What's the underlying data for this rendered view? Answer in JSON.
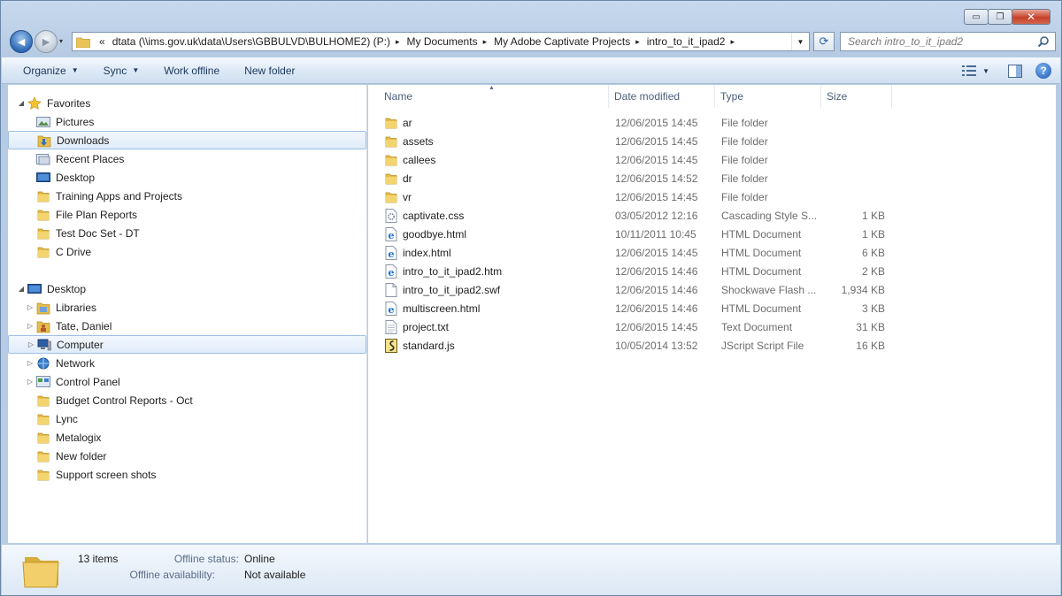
{
  "window": {
    "caption_buttons": {
      "minimize": "▭",
      "maximize": "❐",
      "close": "✕"
    }
  },
  "nav": {
    "back_glyph": "◄",
    "forward_glyph": "►",
    "history_glyph": "▾",
    "address_overflow": "«",
    "breadcrumbs": [
      "dtata (\\\\ims.gov.uk\\data\\Users\\GBBULVD\\BULHOME2) (P:)",
      "My Documents",
      "My Adobe Captivate Projects",
      "intro_to_it_ipad2"
    ],
    "crumb_separator": "▸",
    "address_dropdown_glyph": "▼",
    "refresh_glyph": "⟳",
    "search_placeholder": "Search intro_to_it_ipad2"
  },
  "toolbar": {
    "organize": "Organize",
    "sync": "Sync",
    "work_offline": "Work offline",
    "new_folder": "New folder",
    "dropdown_glyph": "▼",
    "help_glyph": "?"
  },
  "navpane": {
    "expander_open": "◢",
    "expander_closed": "▷",
    "favorites_label": "Favorites",
    "favorites": [
      {
        "label": "Pictures",
        "icon": "pictures-icon"
      },
      {
        "label": "Downloads",
        "icon": "downloads-icon",
        "selected": true
      },
      {
        "label": "Recent Places",
        "icon": "recent-places-icon"
      },
      {
        "label": "Desktop",
        "icon": "desktop-icon"
      },
      {
        "label": "Training Apps and Projects",
        "icon": "folder-icon"
      },
      {
        "label": "File Plan Reports",
        "icon": "folder-icon"
      },
      {
        "label": "Test Doc Set - DT",
        "icon": "folder-icon"
      },
      {
        "label": "C Drive",
        "icon": "folder-icon"
      }
    ],
    "desktop_label": "Desktop",
    "desktop_children": [
      {
        "label": "Libraries",
        "icon": "libraries-icon",
        "expandable": true
      },
      {
        "label": "Tate, Daniel",
        "icon": "user-folder-icon",
        "expandable": true
      },
      {
        "label": "Computer",
        "icon": "computer-icon",
        "expandable": true,
        "selected": true
      },
      {
        "label": "Network",
        "icon": "network-icon",
        "expandable": true
      },
      {
        "label": "Control Panel",
        "icon": "control-panel-icon",
        "expandable": true
      },
      {
        "label": "Budget Control Reports - Oct",
        "icon": "folder-icon"
      },
      {
        "label": "Lync",
        "icon": "folder-icon"
      },
      {
        "label": "Metalogix",
        "icon": "folder-icon"
      },
      {
        "label": "New folder",
        "icon": "folder-icon"
      },
      {
        "label": "Support screen shots",
        "icon": "folder-icon"
      }
    ]
  },
  "filelist": {
    "columns": {
      "name": "Name",
      "date": "Date modified",
      "type": "Type",
      "size": "Size"
    },
    "sort_glyph": "▲",
    "rows": [
      {
        "name": "ar",
        "date": "12/06/2015 14:45",
        "type": "File folder",
        "size": "",
        "icon": "folder-icon"
      },
      {
        "name": "assets",
        "date": "12/06/2015 14:45",
        "type": "File folder",
        "size": "",
        "icon": "folder-icon"
      },
      {
        "name": "callees",
        "date": "12/06/2015 14:45",
        "type": "File folder",
        "size": "",
        "icon": "folder-icon"
      },
      {
        "name": "dr",
        "date": "12/06/2015 14:52",
        "type": "File folder",
        "size": "",
        "icon": "folder-icon"
      },
      {
        "name": "vr",
        "date": "12/06/2015 14:45",
        "type": "File folder",
        "size": "",
        "icon": "folder-icon"
      },
      {
        "name": "captivate.css",
        "date": "03/05/2012 12:16",
        "type": "Cascading Style S...",
        "size": "1 KB",
        "icon": "css-file-icon"
      },
      {
        "name": "goodbye.html",
        "date": "10/11/2011 10:45",
        "type": "HTML Document",
        "size": "1 KB",
        "icon": "html-file-icon"
      },
      {
        "name": "index.html",
        "date": "12/06/2015 14:45",
        "type": "HTML Document",
        "size": "6 KB",
        "icon": "html-file-icon"
      },
      {
        "name": "intro_to_it_ipad2.htm",
        "date": "12/06/2015 14:46",
        "type": "HTML Document",
        "size": "2 KB",
        "icon": "html-file-icon"
      },
      {
        "name": "intro_to_it_ipad2.swf",
        "date": "12/06/2015 14:46",
        "type": "Shockwave Flash ...",
        "size": "1,934 KB",
        "icon": "blank-file-icon"
      },
      {
        "name": "multiscreen.html",
        "date": "12/06/2015 14:46",
        "type": "HTML Document",
        "size": "3 KB",
        "icon": "html-file-icon"
      },
      {
        "name": "project.txt",
        "date": "12/06/2015 14:45",
        "type": "Text Document",
        "size": "31 KB",
        "icon": "text-file-icon"
      },
      {
        "name": "standard.js",
        "date": "10/05/2014 13:52",
        "type": "JScript Script File",
        "size": "16 KB",
        "icon": "js-file-icon"
      }
    ]
  },
  "details": {
    "count": "13 items",
    "offline_status_label": "Offline status:",
    "offline_status_value": "Online",
    "offline_availability_label": "Offline availability:",
    "offline_availability_value": "Not available"
  }
}
